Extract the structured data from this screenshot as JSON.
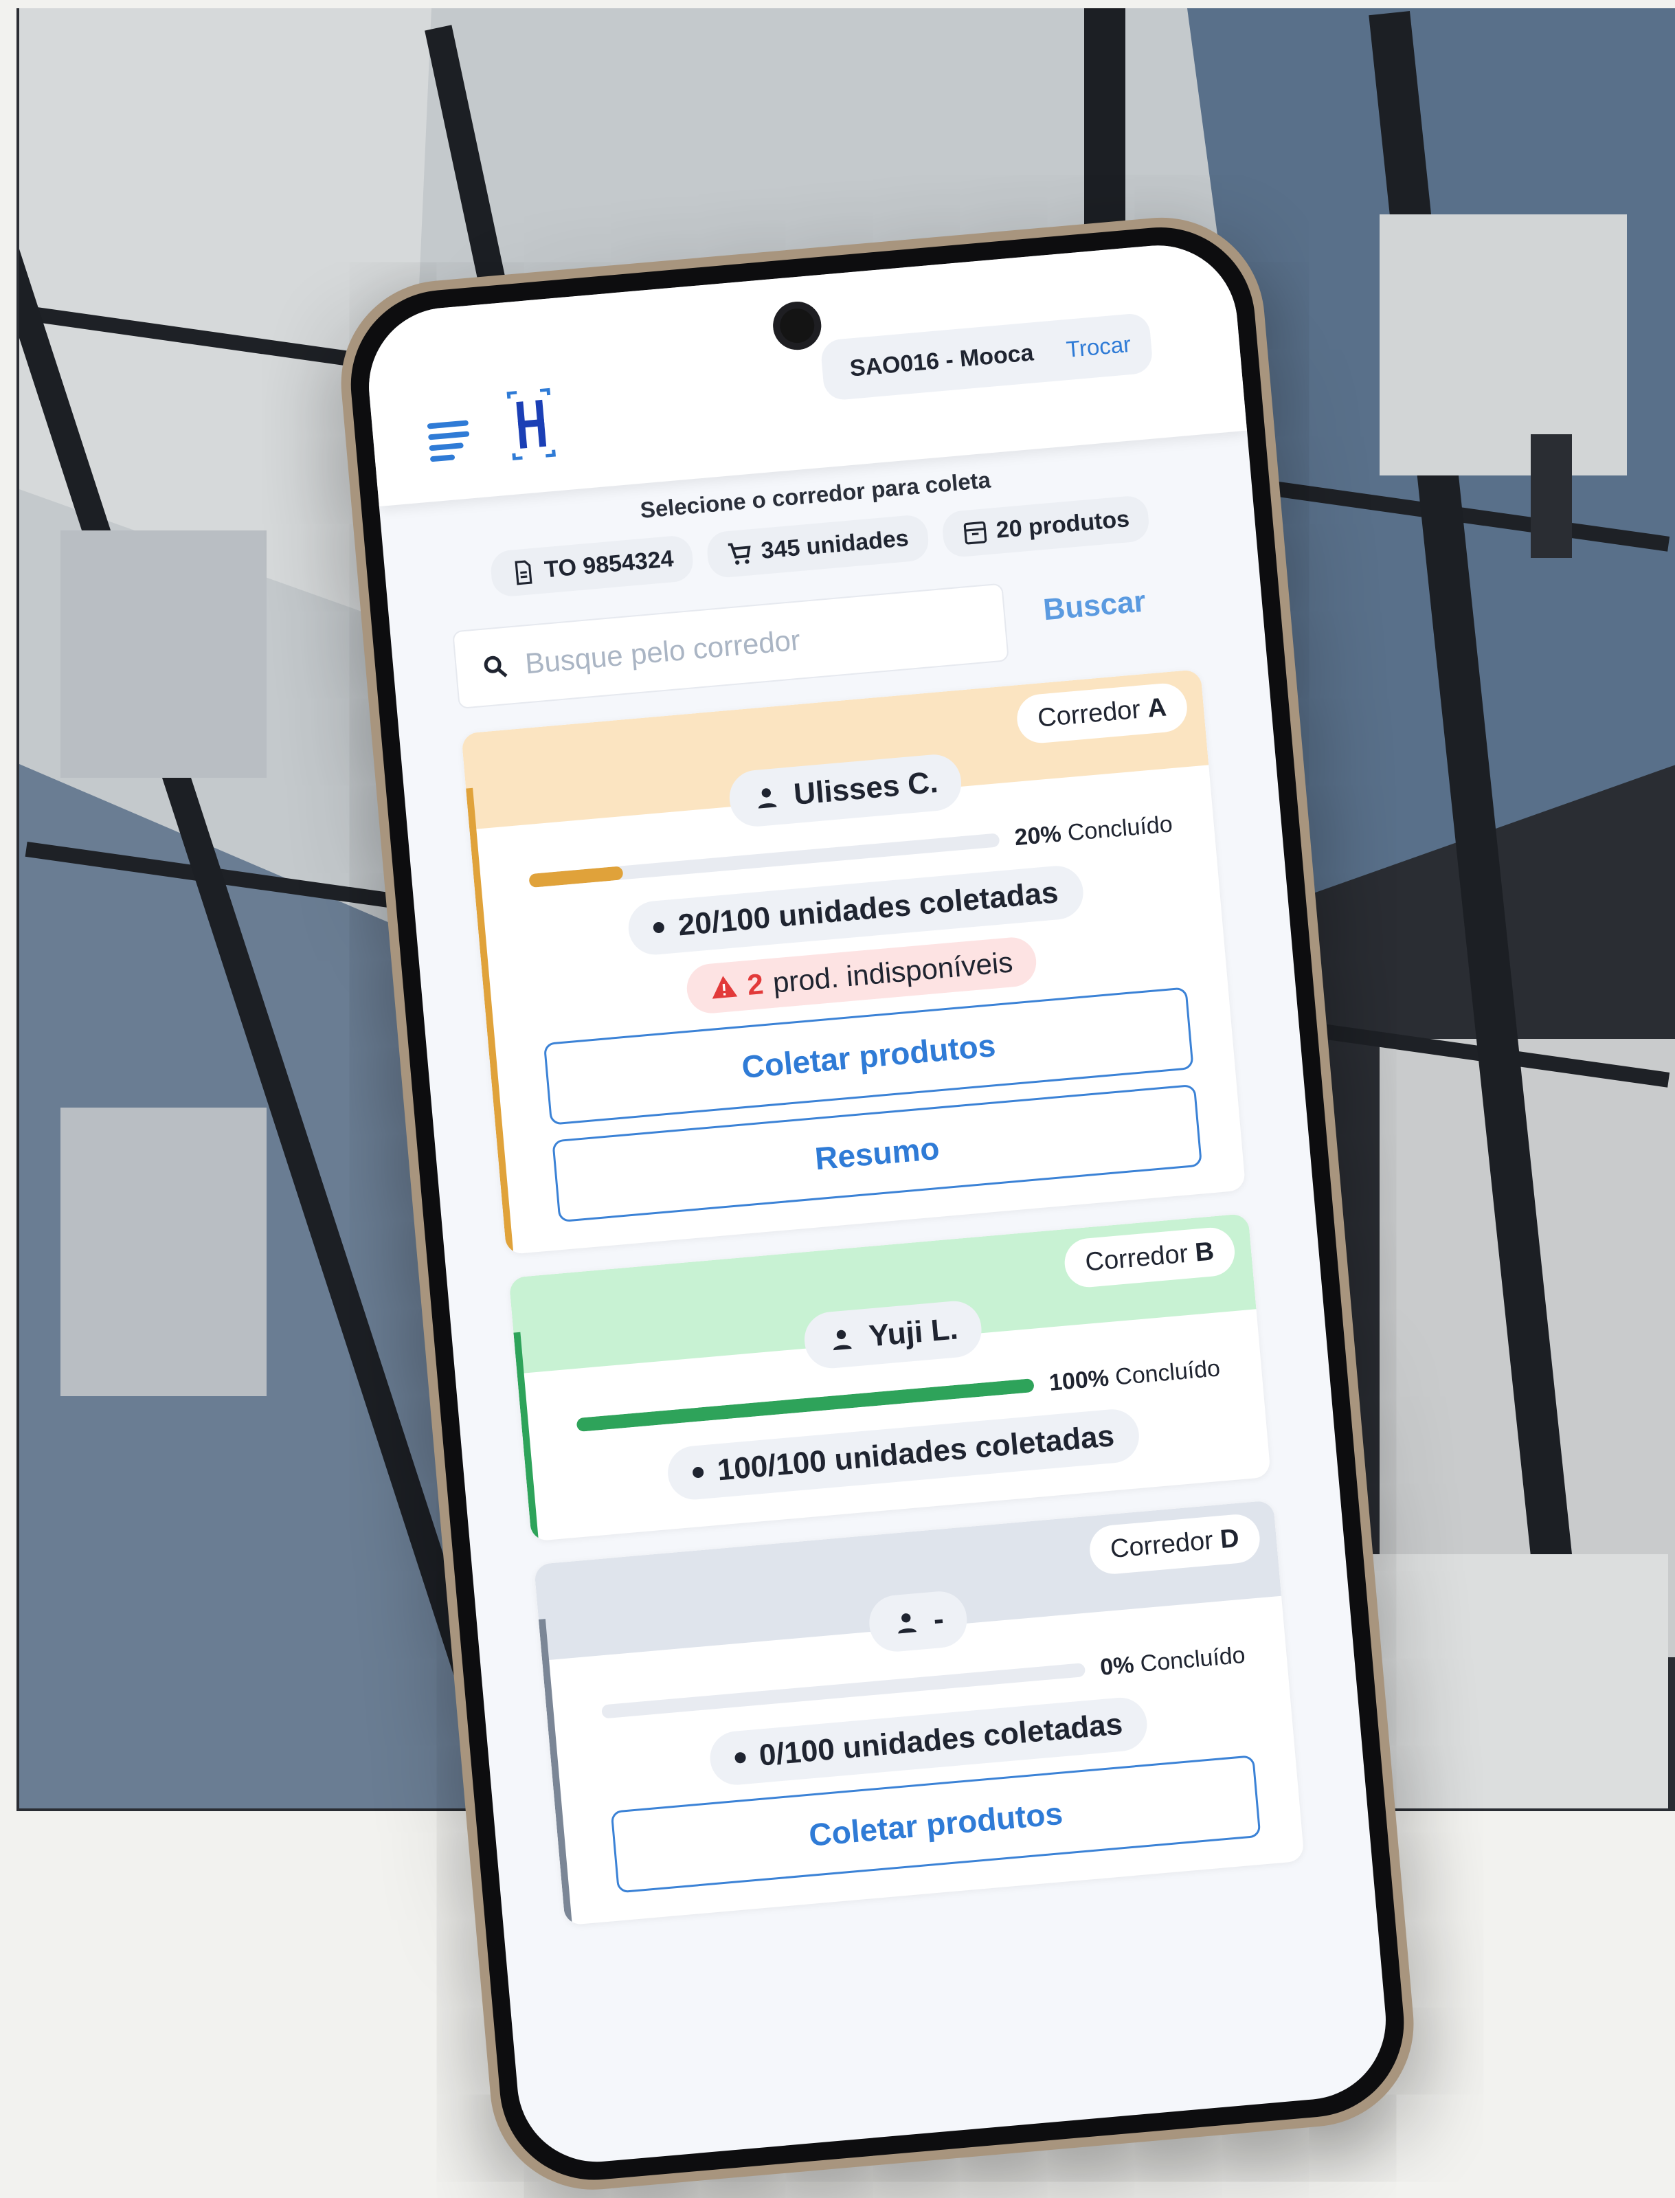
{
  "header": {
    "store_name": "SAO016 - Mooca",
    "switch_label": "Trocar"
  },
  "summary": {
    "subtitle": "Selecione o corredor para coleta",
    "order_id": "TO 9854324",
    "units": "345 unidades",
    "products": "20 produtos"
  },
  "search": {
    "placeholder": "Busque pelo corredor",
    "value": "",
    "button_label": "Buscar"
  },
  "corridors": [
    {
      "label_prefix": "Corredor",
      "letter": "A",
      "user": "Ulisses C.",
      "progress": 0.2,
      "percent": "20%",
      "percent_suffix": "Concluído",
      "units_collected": "20/100 unidades coletadas",
      "unavailable_count": "2",
      "unavailable_text": "prod. indisponíveis",
      "collect_label": "Coletar produtos",
      "summary_label": "Resumo",
      "header_color": "#fbe4c1",
      "accent_color": "#e0a23a"
    },
    {
      "label_prefix": "Corredor",
      "letter": "B",
      "user": "Yuji L.",
      "progress": 1.0,
      "percent": "100%",
      "percent_suffix": "Concluído",
      "units_collected": "100/100 unidades coletadas",
      "header_color": "#c8f2d3",
      "accent_color": "#2ea35a"
    },
    {
      "label_prefix": "Corredor",
      "letter": "D",
      "user": "-",
      "progress": 0,
      "percent": "0%",
      "percent_suffix": "Concluído",
      "units_collected": "0/100 unidades coletadas",
      "collect_label": "Coletar produtos",
      "header_color": "#dfe4ec",
      "accent_color": "#7b8696"
    }
  ],
  "icons": {
    "menu": "menu-icon",
    "logo": "logo-icon",
    "order": "document-icon",
    "units": "cart-icon",
    "products": "box-icon",
    "search": "search-icon",
    "user": "person-icon",
    "warning": "warning-icon"
  }
}
